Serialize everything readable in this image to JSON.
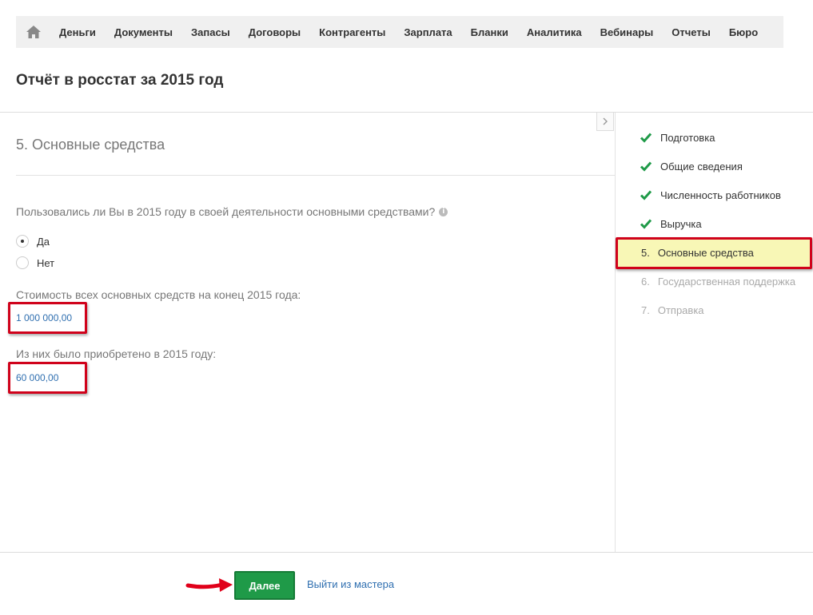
{
  "nav": {
    "items": [
      "Деньги",
      "Документы",
      "Запасы",
      "Договоры",
      "Контрагенты",
      "Зарплата",
      "Бланки",
      "Аналитика",
      "Вебинары",
      "Отчеты",
      "Бюро"
    ]
  },
  "page": {
    "title": "Отчёт в росстат за 2015 год"
  },
  "section": {
    "title": "5. Основные средства",
    "question": "Пользовались ли Вы в 2015 году в своей деятельности основными средствами?",
    "options": [
      {
        "label": "Да",
        "selected": true
      },
      {
        "label": "Нет",
        "selected": false
      }
    ],
    "cost_label": "Стоимость всех основных средств на конец 2015 года:",
    "cost_value": "1 000 000,00",
    "acquired_label": "Из них было приобретено в 2015 году:",
    "acquired_value": "60 000,00"
  },
  "steps": [
    {
      "label": "Подготовка",
      "status": "done"
    },
    {
      "label": "Общие сведения",
      "status": "done"
    },
    {
      "label": "Численность работников",
      "status": "done"
    },
    {
      "label": "Выручка",
      "status": "done"
    },
    {
      "num": "5.",
      "label": "Основные средства",
      "status": "active"
    },
    {
      "num": "6.",
      "label": "Государственная поддержка",
      "status": "pending"
    },
    {
      "num": "7.",
      "label": "Отправка",
      "status": "pending"
    }
  ],
  "footer": {
    "next_label": "Далее",
    "exit_label": "Выйти из мастера"
  },
  "colors": {
    "accent_green": "#1f9a48",
    "link_blue": "#2f6fb0",
    "highlight_red": "#d0021b",
    "active_step_bg": "#f8f7b6"
  }
}
